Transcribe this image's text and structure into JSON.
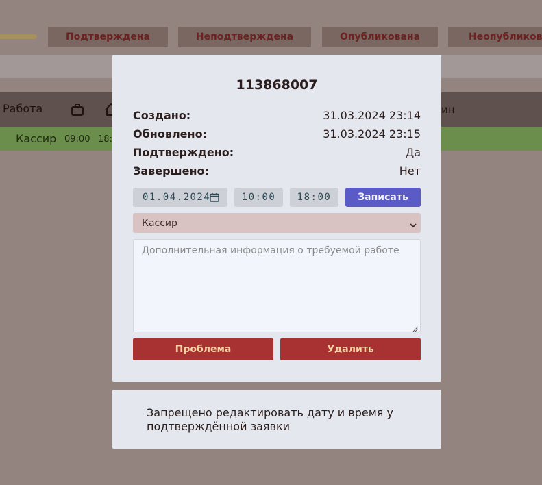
{
  "filters": {
    "confirmed": "Подтверждена",
    "unconfirmed": "Неподтверждена",
    "published": "Опубликована",
    "unpublished": "Неопубликована"
  },
  "nav": {
    "work_label": "Работа",
    "right_partial": "ин"
  },
  "schedule_row": {
    "role": "Кассир",
    "start": "09:00",
    "end_partial": "18:"
  },
  "modal": {
    "title": "113868007",
    "info": [
      {
        "label": "Создано:",
        "value": "31.03.2024 23:14"
      },
      {
        "label": "Обновлено:",
        "value": "31.03.2024 23:15"
      },
      {
        "label": "Подтверждено:",
        "value": "Да"
      },
      {
        "label": "Завершено:",
        "value": "Нет"
      }
    ],
    "date_value": "01.04.2024",
    "time_start": "10:00",
    "time_end": "18:00",
    "save_label": "Записать",
    "role_selected": "Кассир",
    "notes_placeholder": "Дополнительная информация о требуемой работе",
    "problem_label": "Проблема",
    "delete_label": "Удалить"
  },
  "notice": {
    "text": "Запрещено редактировать дату и время у подтверждённой заявки"
  },
  "icons": {
    "nav_bag": "briefcase-icon",
    "nav_home": "home-icon",
    "calendar": "calendar-icon",
    "select_chevron": "chevron-down-icon"
  },
  "colors": {
    "overlay_bg": "#938480",
    "modal_bg": "#e5e7ee",
    "save_button": "#5b5bc8",
    "danger_button": "#a83232",
    "schedule_row": "#6c8e4c"
  }
}
